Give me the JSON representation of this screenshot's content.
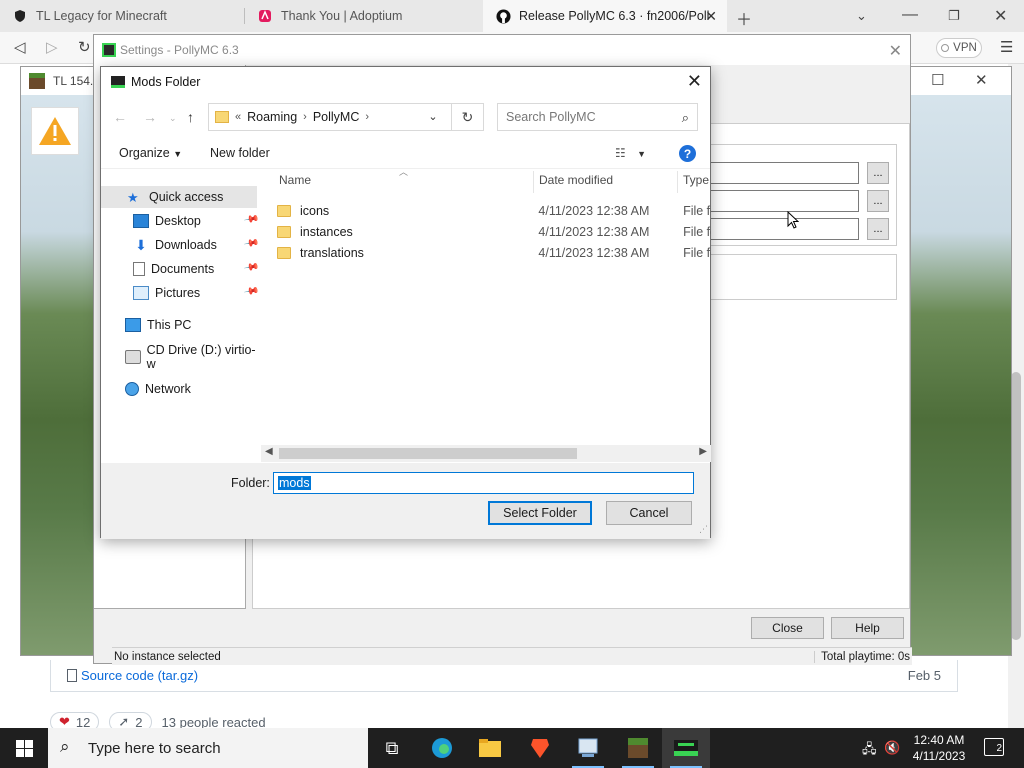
{
  "browser": {
    "tabs": [
      {
        "title": "TL Legacy for Minecraft",
        "icon": "shield-icon"
      },
      {
        "title": "Thank You | Adoptium",
        "icon": "adoptium-icon"
      },
      {
        "title": "Release PollyMC 6.3 · fn2006/Poll",
        "icon": "github-icon"
      }
    ],
    "vpn_label": "VPN"
  },
  "github_page": {
    "asset_link": "Source code (tar.gz)",
    "asset_date": "Feb 5",
    "heart_count": "12",
    "rocket_count": "2",
    "reacted_text": "13 people reacted"
  },
  "tl_window": {
    "title": "TL 154.2"
  },
  "pollymc": {
    "title": "Settings - PollyMC 6.3",
    "close_label": "Close",
    "help_label": "Help",
    "browse_label": "...",
    "status_left": "No instance selected",
    "status_right": "Total playtime: 0s"
  },
  "dialog": {
    "title": "Mods Folder",
    "breadcrumb": [
      "«",
      "Roaming",
      "PollyMC"
    ],
    "search_placeholder": "Search PollyMC",
    "organize_label": "Organize",
    "new_folder_label": "New folder",
    "nav": [
      {
        "label": "Quick access",
        "icon": "star-icon",
        "pinned": false
      },
      {
        "label": "Desktop",
        "icon": "desktop-icon",
        "pinned": true
      },
      {
        "label": "Downloads",
        "icon": "download-icon",
        "pinned": true
      },
      {
        "label": "Documents",
        "icon": "document-icon",
        "pinned": true
      },
      {
        "label": "Pictures",
        "icon": "picture-icon",
        "pinned": true
      },
      {
        "label": "This PC",
        "icon": "computer-icon",
        "pinned": false
      },
      {
        "label": "CD Drive (D:) virtio-w",
        "icon": "cd-drive-icon",
        "pinned": false
      },
      {
        "label": "Network",
        "icon": "network-icon",
        "pinned": false
      }
    ],
    "columns": {
      "name": "Name",
      "date": "Date modified",
      "type": "Type"
    },
    "files": [
      {
        "name": "icons",
        "date": "4/11/2023 12:38 AM",
        "type": "File fo"
      },
      {
        "name": "instances",
        "date": "4/11/2023 12:38 AM",
        "type": "File fo"
      },
      {
        "name": "translations",
        "date": "4/11/2023 12:38 AM",
        "type": "File fo"
      }
    ],
    "folder_label": "Folder:",
    "folder_value": "mods",
    "select_label": "Select Folder",
    "cancel_label": "Cancel"
  },
  "taskbar": {
    "search_placeholder": "Type here to search",
    "time": "12:40 AM",
    "date": "4/11/2023",
    "notification_count": "2"
  },
  "colors": {
    "accent": "#0078d7",
    "taskbar": "#1f1f1f",
    "folder": "#f8d775"
  }
}
